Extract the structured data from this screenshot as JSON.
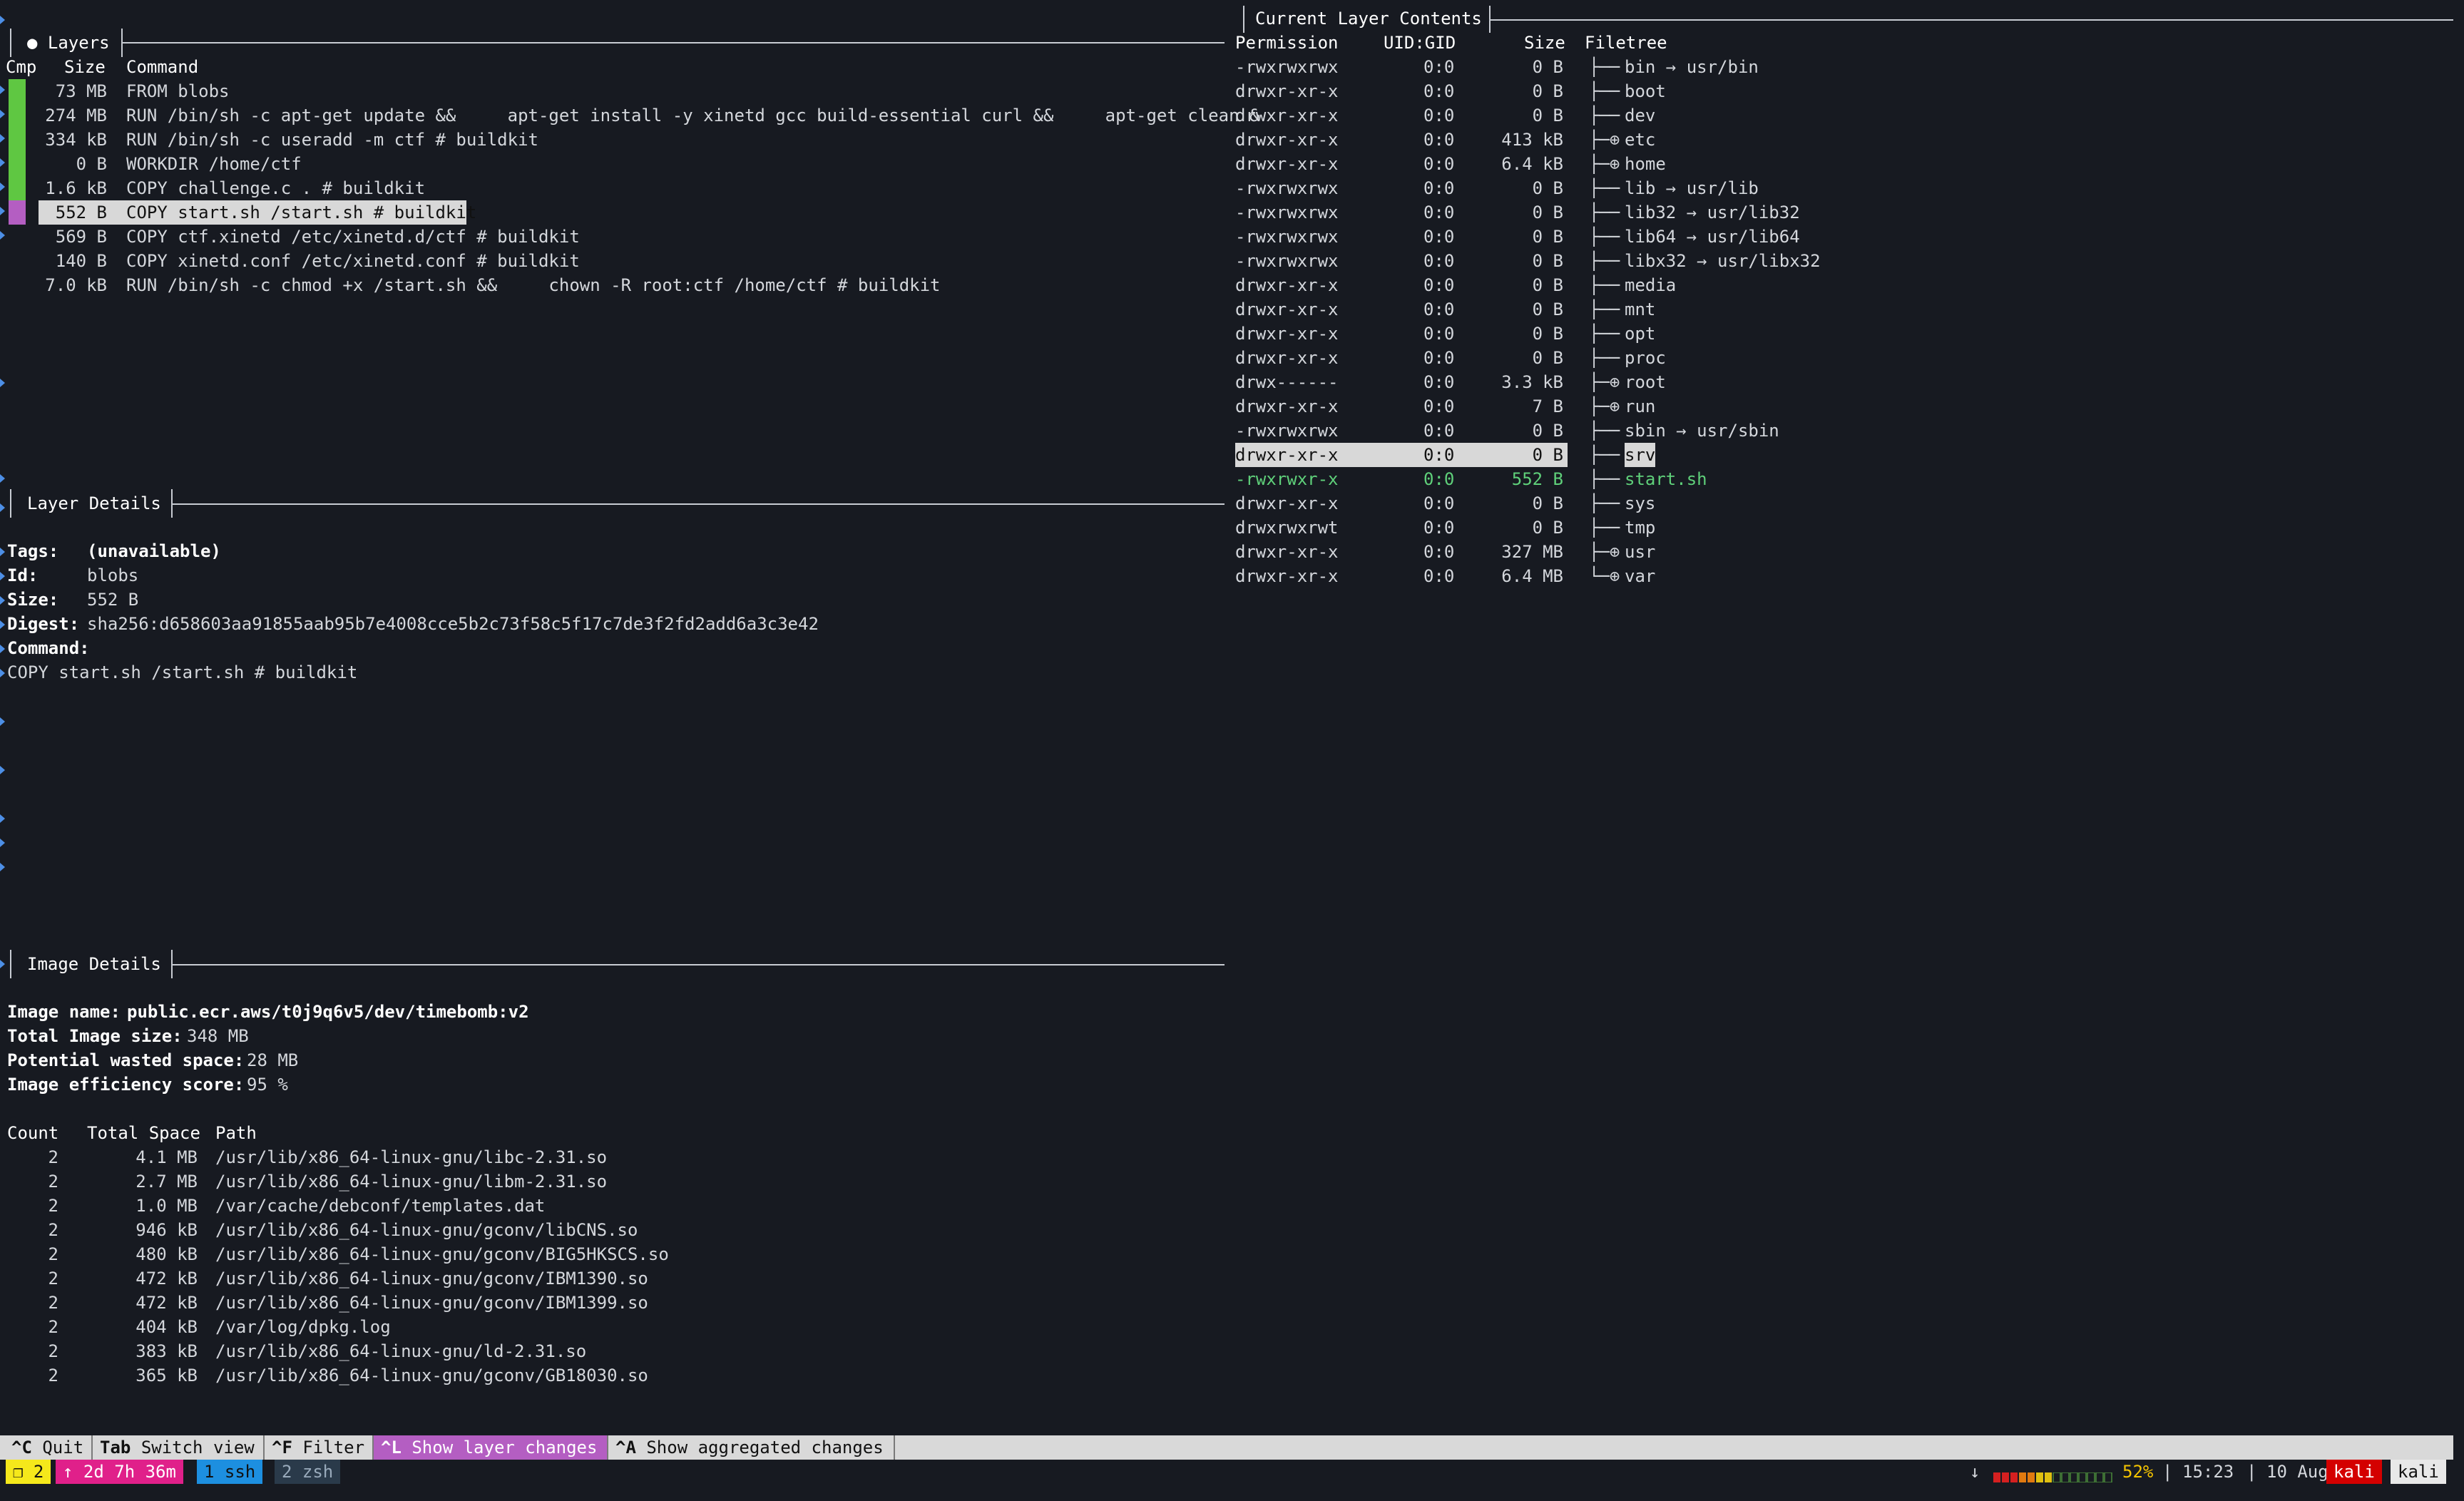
{
  "layers_panel": {
    "title": "● Layers",
    "col_cmp": "Cmp",
    "col_size": "Size",
    "col_command": "Command",
    "rows": [
      {
        "size": "73 MB",
        "command": "FROM blobs",
        "color": "#5fc742"
      },
      {
        "size": "274 MB",
        "command": "RUN /bin/sh -c apt-get update &&     apt-get install -y xinetd gcc build-essential curl &&     apt-get clean &",
        "color": "#5fc742"
      },
      {
        "size": "334 kB",
        "command": "RUN /bin/sh -c useradd -m ctf # buildkit",
        "color": "#5fc742"
      },
      {
        "size": "0 B",
        "command": "WORKDIR /home/ctf",
        "color": "#5fc742"
      },
      {
        "size": "1.6 kB",
        "command": "COPY challenge.c . # buildkit",
        "color": "#5fc742"
      },
      {
        "size": "552 B",
        "command": "COPY start.sh /start.sh # buildkit",
        "color": "#b45ec2",
        "selected": true
      },
      {
        "size": "569 B",
        "command": "COPY ctf.xinetd /etc/xinetd.d/ctf # buildkit"
      },
      {
        "size": "140 B",
        "command": "COPY xinetd.conf /etc/xinetd.conf # buildkit"
      },
      {
        "size": "7.0 kB",
        "command": "RUN /bin/sh -c chmod +x /start.sh &&     chown -R root:ctf /home/ctf # buildkit"
      }
    ]
  },
  "layer_details": {
    "title": "Layer Details",
    "tags_label": "Tags:",
    "tags_value": "(unavailable)",
    "id_label": "Id:",
    "id_value": "blobs",
    "size_label": "Size:",
    "size_value": "552 B",
    "digest_label": "Digest:",
    "digest_value": "sha256:d658603aa91855aab95b7e4008cce5b2c73f58c5f17c7de3f2fd2add6a3c3e42",
    "command_label": "Command:",
    "command_value": "COPY start.sh /start.sh # buildkit"
  },
  "image_details": {
    "title": "Image Details",
    "name_label": "Image name:",
    "name_value": "public.ecr.aws/t0j9q6v5/dev/timebomb:v2",
    "total_label": "Total Image size:",
    "total_value": "348 MB",
    "wasted_label": "Potential wasted space:",
    "wasted_value": "28 MB",
    "efficiency_label": "Image efficiency score:",
    "efficiency_value": "95 %",
    "col_count": "Count",
    "col_total": "Total Space",
    "col_path": "Path",
    "rows": [
      {
        "count": "2",
        "space": "4.1 MB",
        "path": "/usr/lib/x86_64-linux-gnu/libc-2.31.so"
      },
      {
        "count": "2",
        "space": "2.7 MB",
        "path": "/usr/lib/x86_64-linux-gnu/libm-2.31.so"
      },
      {
        "count": "2",
        "space": "1.0 MB",
        "path": "/var/cache/debconf/templates.dat"
      },
      {
        "count": "2",
        "space": "946 kB",
        "path": "/usr/lib/x86_64-linux-gnu/gconv/libCNS.so"
      },
      {
        "count": "2",
        "space": "480 kB",
        "path": "/usr/lib/x86_64-linux-gnu/gconv/BIG5HKSCS.so"
      },
      {
        "count": "2",
        "space": "472 kB",
        "path": "/usr/lib/x86_64-linux-gnu/gconv/IBM1390.so"
      },
      {
        "count": "2",
        "space": "472 kB",
        "path": "/usr/lib/x86_64-linux-gnu/gconv/IBM1399.so"
      },
      {
        "count": "2",
        "space": "404 kB",
        "path": "/var/log/dpkg.log"
      },
      {
        "count": "2",
        "space": "383 kB",
        "path": "/usr/lib/x86_64-linux-gnu/ld-2.31.so"
      },
      {
        "count": "2",
        "space": "365 kB",
        "path": "/usr/lib/x86_64-linux-gnu/gconv/GB18030.so"
      }
    ]
  },
  "contents_panel": {
    "title": "Current Layer Contents",
    "col_permission": "Permission",
    "col_uidgid": "UID:GID",
    "col_size": "Size",
    "col_filetree": "Filetree",
    "rows": [
      {
        "perm": "-rwxrwxrwx",
        "uid": "0:0",
        "size": "0 B",
        "branch": "├──",
        "name": "bin → usr/bin"
      },
      {
        "perm": "drwxr-xr-x",
        "uid": "0:0",
        "size": "0 B",
        "branch": "├──",
        "name": "boot"
      },
      {
        "perm": "drwxr-xr-x",
        "uid": "0:0",
        "size": "0 B",
        "branch": "├──",
        "name": "dev"
      },
      {
        "perm": "drwxr-xr-x",
        "uid": "0:0",
        "size": "413 kB",
        "branch": "├─⊕",
        "name": "etc"
      },
      {
        "perm": "drwxr-xr-x",
        "uid": "0:0",
        "size": "6.4 kB",
        "branch": "├─⊕",
        "name": "home"
      },
      {
        "perm": "-rwxrwxrwx",
        "uid": "0:0",
        "size": "0 B",
        "branch": "├──",
        "name": "lib → usr/lib"
      },
      {
        "perm": "-rwxrwxrwx",
        "uid": "0:0",
        "size": "0 B",
        "branch": "├──",
        "name": "lib32 → usr/lib32"
      },
      {
        "perm": "-rwxrwxrwx",
        "uid": "0:0",
        "size": "0 B",
        "branch": "├──",
        "name": "lib64 → usr/lib64"
      },
      {
        "perm": "-rwxrwxrwx",
        "uid": "0:0",
        "size": "0 B",
        "branch": "├──",
        "name": "libx32 → usr/libx32"
      },
      {
        "perm": "drwxr-xr-x",
        "uid": "0:0",
        "size": "0 B",
        "branch": "├──",
        "name": "media"
      },
      {
        "perm": "drwxr-xr-x",
        "uid": "0:0",
        "size": "0 B",
        "branch": "├──",
        "name": "mnt"
      },
      {
        "perm": "drwxr-xr-x",
        "uid": "0:0",
        "size": "0 B",
        "branch": "├──",
        "name": "opt"
      },
      {
        "perm": "drwxr-xr-x",
        "uid": "0:0",
        "size": "0 B",
        "branch": "├──",
        "name": "proc"
      },
      {
        "perm": "drwx------",
        "uid": "0:0",
        "size": "3.3 kB",
        "branch": "├─⊕",
        "name": "root"
      },
      {
        "perm": "drwxr-xr-x",
        "uid": "0:0",
        "size": "7 B",
        "branch": "├─⊕",
        "name": "run"
      },
      {
        "perm": "-rwxrwxrwx",
        "uid": "0:0",
        "size": "0 B",
        "branch": "├──",
        "name": "sbin → usr/sbin"
      },
      {
        "perm": "drwxr-xr-x",
        "uid": "0:0",
        "size": "0 B",
        "branch": "├──",
        "name": "srv",
        "selected": true
      },
      {
        "perm": "-rwxrwxr-x",
        "uid": "0:0",
        "size": "552 B",
        "branch": "├──",
        "name": "start.sh",
        "added": true
      },
      {
        "perm": "drwxr-xr-x",
        "uid": "0:0",
        "size": "0 B",
        "branch": "├──",
        "name": "sys"
      },
      {
        "perm": "drwxrwxrwt",
        "uid": "0:0",
        "size": "0 B",
        "branch": "├──",
        "name": "tmp"
      },
      {
        "perm": "drwxr-xr-x",
        "uid": "0:0",
        "size": "327 MB",
        "branch": "├─⊕",
        "name": "usr"
      },
      {
        "perm": "drwxr-xr-x",
        "uid": "0:0",
        "size": "6.4 MB",
        "branch": "└─⊕",
        "name": "var"
      }
    ]
  },
  "keybar": [
    {
      "key": "^C",
      "label": "Quit"
    },
    {
      "key": "Tab",
      "label": "Switch view"
    },
    {
      "key": "^F",
      "label": "Filter"
    },
    {
      "key": "^L",
      "label": "Show layer changes",
      "active": true
    },
    {
      "key": "^A",
      "label": "Show aggregated changes"
    }
  ],
  "tmux": {
    "session": "❐ 2",
    "uptime": "↑ 2d 7h 36m",
    "win1": "1 ssh",
    "win2": "2 zsh",
    "arrow": "↓",
    "battery_pct": "52%",
    "battery_level": 0.52,
    "time": "15:23",
    "date": "10 Aug",
    "user": "kali",
    "host": "kali",
    "sep": "|",
    "colors": {
      "session": "#f5e81b",
      "uptime": "#e0208a",
      "win1": "#1d8fe0",
      "win2": "#2a3a4a",
      "user": "#d40000"
    }
  }
}
